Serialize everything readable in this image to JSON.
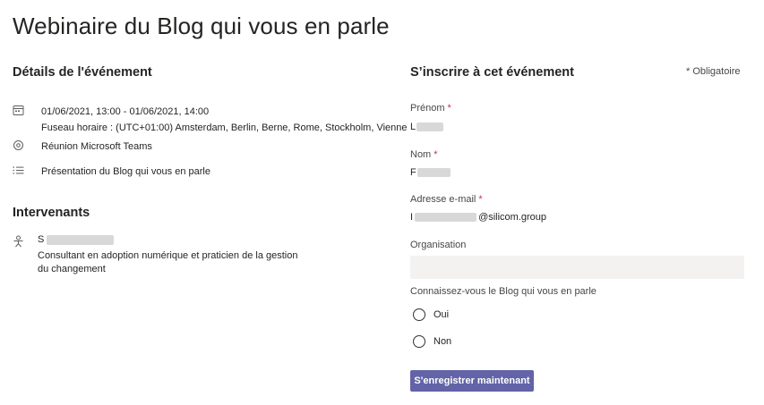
{
  "page": {
    "title": "Webinaire du Blog qui vous en parle"
  },
  "details": {
    "title": "Détails de l'événement",
    "date_range": "01/06/2021, 13:00 - 01/06/2021, 14:00",
    "timezone": "Fuseau horaire : (UTC+01:00) Amsterdam, Berlin, Berne, Rome, Stockholm, Vienne",
    "location": "Réunion Microsoft Teams",
    "description": "Présentation du Blog qui vous en parle"
  },
  "speakers": {
    "title": "Intervenants",
    "items": [
      {
        "name_initial": "S",
        "bio": "Consultant en adoption numérique et praticien de la gestion du changement"
      }
    ]
  },
  "registration": {
    "title": "S’inscrire à cet événement",
    "required_note": "* Obligatoire",
    "required_marker": "*",
    "fields": {
      "first_name": {
        "label": "Prénom",
        "value_initial": "L"
      },
      "last_name": {
        "label": "Nom",
        "value_initial": "F"
      },
      "email": {
        "label": "Adresse e-mail",
        "value_initial": "I",
        "domain": "@silicom.group"
      },
      "organisation": {
        "label": "Organisation",
        "value": ""
      }
    },
    "question": {
      "label": "Connaissez-vous le Blog qui vous en parle",
      "options": [
        "Oui",
        "Non"
      ]
    },
    "submit_label": "S'enregistrer maintenant"
  },
  "colors": {
    "accent": "#6264a7",
    "required": "#c4314b",
    "input_bg": "#f3f2f1"
  },
  "icons": {
    "date": "calendar-icon",
    "location": "location-pin-icon",
    "description": "list-icon",
    "speaker": "person-icon"
  }
}
